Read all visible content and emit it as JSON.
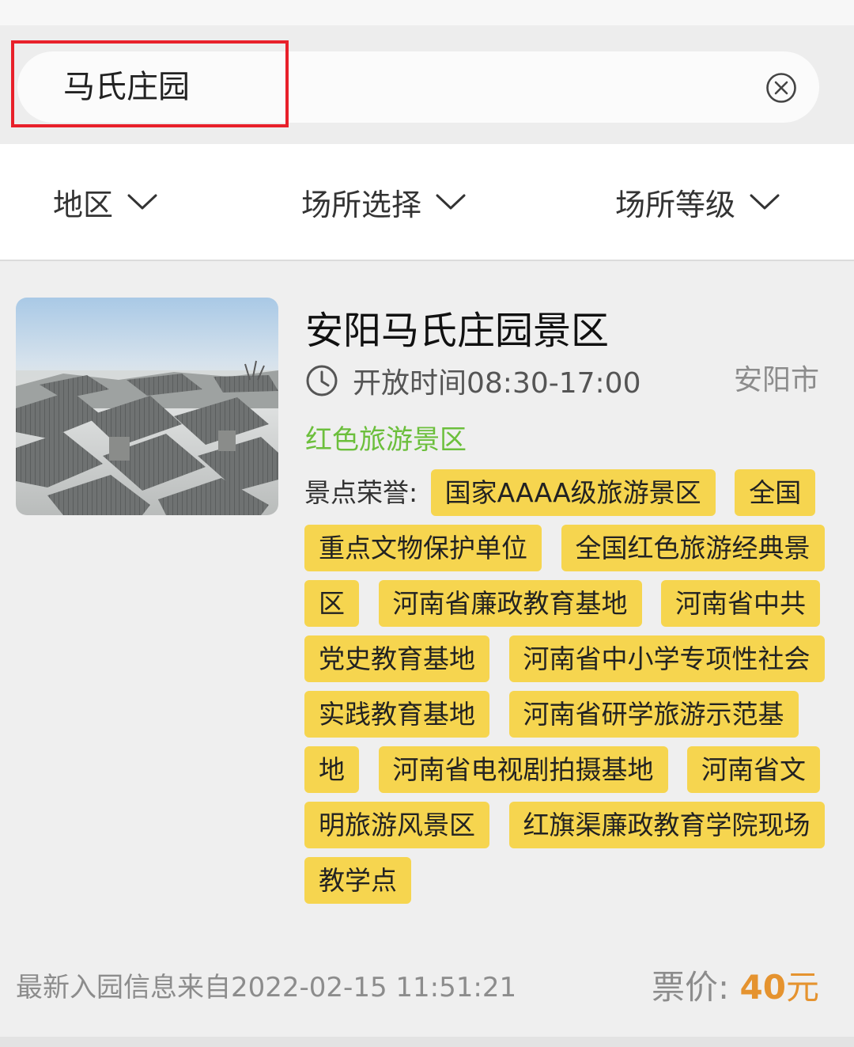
{
  "search": {
    "value": "马氏庄园",
    "clear_icon": "close-circle-icon"
  },
  "filters": [
    {
      "label": "地区",
      "icon": "chevron-down-icon"
    },
    {
      "label": "场所选择",
      "icon": "chevron-down-icon"
    },
    {
      "label": "场所等级",
      "icon": "chevron-down-icon"
    }
  ],
  "result": {
    "title": "安阳马氏庄园景区",
    "time_icon": "clock-icon",
    "open_time": "开放时间08:30-17:00",
    "city": "安阳市",
    "category": "红色旅游景区",
    "honors_label": "景点荣誉:",
    "honors": [
      "国家AAAA级旅游景区",
      "全国重点文物保护单位",
      "全国红色旅游经典景区",
      "河南省廉政教育基地",
      "河南省中共党史教育基地",
      "河南省中小学专项性社会实践教育基地",
      "河南省研学旅游示范基地",
      "河南省电视剧拍摄基地",
      "河南省文明旅游风景区",
      "红旗渠廉政教育学院现场教学点"
    ],
    "update_info": "最新入园信息来自2022-02-15 11:51:21",
    "price_label": "票价:",
    "price_value": "40",
    "price_unit": "元"
  },
  "colors": {
    "highlight_box": "#e8202a",
    "category_green": "#6cbf3c",
    "tag_yellow": "#f6d54f",
    "price_orange": "#e5932f"
  }
}
